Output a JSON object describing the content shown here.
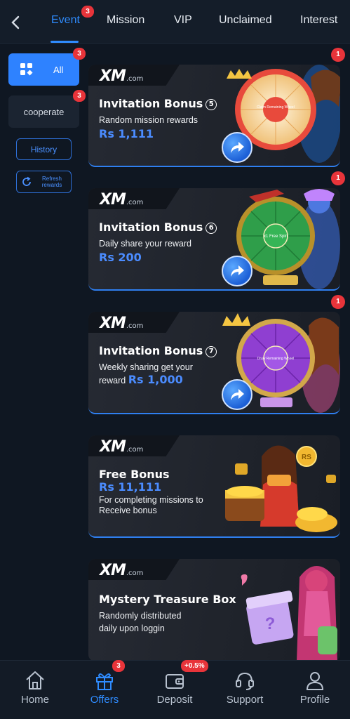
{
  "tabs": [
    {
      "label": "Event",
      "badge": "3"
    },
    {
      "label": "Mission"
    },
    {
      "label": "VIP"
    },
    {
      "label": "Unclaimed"
    },
    {
      "label": "Interest"
    }
  ],
  "sidebar": {
    "all_label": "All",
    "all_badge": "3",
    "cooperate_label": "cooperate",
    "cooperate_badge": "3",
    "history_label": "History",
    "refresh_label": "Refresh rewards"
  },
  "cards": [
    {
      "logo": "XM",
      "logo_suffix": ".com",
      "title": "Invitation Bonus",
      "number": "5",
      "subtitle": "Random mission rewards",
      "amount": "Rs 1,111",
      "badge": "1",
      "wheel_text": "Claim Remaining Wheel"
    },
    {
      "logo": "XM",
      "logo_suffix": ".com",
      "title": "Invitation Bonus",
      "number": "6",
      "subtitle": "Daily share your reward",
      "amount": "Rs 200",
      "badge": "1",
      "wheel_text": "x1 Free Spin"
    },
    {
      "logo": "XM",
      "logo_suffix": ".com",
      "title": "Invitation Bonus",
      "number": "7",
      "subtitle": "Weekly sharing get your",
      "subtitle_prefix": "reward",
      "amount": "Rs 1,000",
      "badge": "1",
      "wheel_text": "Draw Remaining Wheel"
    },
    {
      "logo": "XM",
      "logo_suffix": ".com",
      "title": "Free Bonus",
      "amount": "Rs 11,111",
      "subtitle_line1": "For completing missions to",
      "subtitle_line2": "Receive bonus",
      "coin_text": "RS"
    },
    {
      "logo": "XM",
      "logo_suffix": ".com",
      "title": "Mystery Treasure Box",
      "subtitle_line1": "Randomly distributed",
      "subtitle_line2": "daily upon loggin"
    }
  ],
  "bottom_nav": [
    {
      "label": "Home",
      "icon": "home-icon"
    },
    {
      "label": "Offers",
      "icon": "gift-icon",
      "badge": "3",
      "active": true
    },
    {
      "label": "Deposit",
      "icon": "wallet-icon",
      "badge": "+0.5%"
    },
    {
      "label": "Support",
      "icon": "headset-icon"
    },
    {
      "label": "Profile",
      "icon": "user-icon"
    }
  ],
  "colors": {
    "accent": "#2f8cff",
    "badge": "#e8343a",
    "background": "#0f1722"
  }
}
